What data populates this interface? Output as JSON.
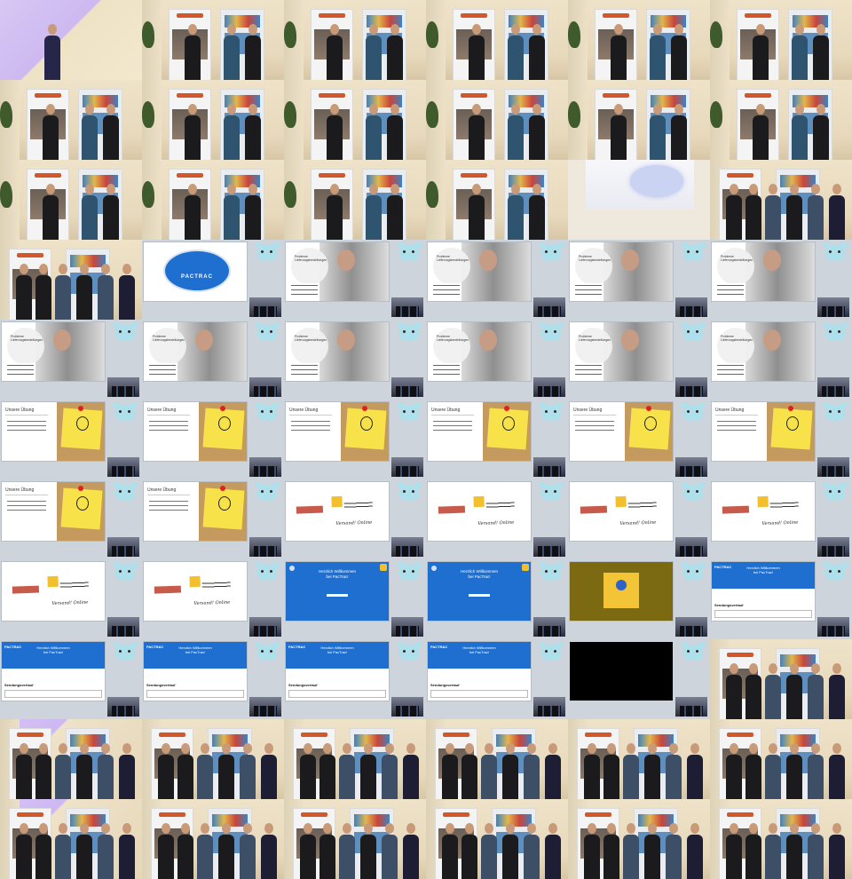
{
  "grid": {
    "columns": 6,
    "rows": 11
  },
  "slides": {
    "logo_text": "PACTRAC",
    "clown_heading": "Probleme Lieferungsbestellungen",
    "idea_heading": "Unsere Übung",
    "sketch_scrawl": "Versand! Online",
    "welcome_line1": "Herzlich Willkommen",
    "welcome_line2": "bei PacTrac!",
    "form_logo": "PACTRAC",
    "form_section": "Sendungsverlauf"
  },
  "colors": {
    "brand_blue": "#1e6fcf",
    "sticky_yellow": "#f7e24a",
    "background": "#cfd4da"
  },
  "cells": [
    "lilac",
    "stage",
    "stage",
    "stage",
    "stage",
    "stage",
    "stage",
    "stage",
    "stage",
    "stage",
    "stage",
    "stage",
    "stage",
    "stage",
    "stage",
    "stage",
    "projector",
    "group",
    "group",
    "shot-logo",
    "shot-clown",
    "shot-clown",
    "shot-clown",
    "shot-clown",
    "shot-clown",
    "shot-clown",
    "shot-clown",
    "shot-clown",
    "shot-clown",
    "shot-clown",
    "shot-idea",
    "shot-idea",
    "shot-idea",
    "shot-idea",
    "shot-idea",
    "shot-idea",
    "shot-idea",
    "shot-idea",
    "shot-sketch",
    "shot-sketch",
    "shot-sketch",
    "shot-sketch",
    "shot-sketch",
    "shot-sketch",
    "shot-blue",
    "shot-blue",
    "shot-olive",
    "shot-form",
    "shot-form",
    "shot-form",
    "shot-form",
    "shot-form",
    "shot-black",
    "group",
    "group-purple",
    "group",
    "group",
    "group",
    "group",
    "group",
    "group-purple",
    "group",
    "group",
    "group",
    "group",
    "group"
  ]
}
